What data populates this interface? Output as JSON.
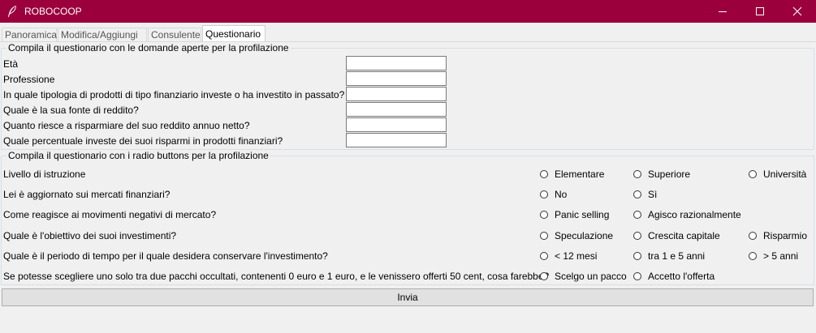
{
  "window": {
    "title": "ROBOCOOP"
  },
  "tabs": [
    {
      "label": "Panoramica"
    },
    {
      "label": "Modifica/Aggiungi"
    },
    {
      "label": "Consulente"
    },
    {
      "label": "Questionario"
    }
  ],
  "open_questions": {
    "title": "Compila il questionario con le domande aperte per la profilazione",
    "fields": [
      {
        "label": "Età",
        "value": ""
      },
      {
        "label": "Professione",
        "value": ""
      },
      {
        "label": "In quale tipologia di prodotti di tipo finanziario investe o ha investito in passato?",
        "value": ""
      },
      {
        "label": "Quale è la sua fonte di reddito?",
        "value": ""
      },
      {
        "label": "Quanto riesce a risparmiare del suo reddito annuo netto?",
        "value": ""
      },
      {
        "label": "Quale percentuale investe dei suoi risparmi in prodotti finanziari?",
        "value": ""
      }
    ]
  },
  "radio_questions": {
    "title": "Compila il questionario con i radio buttons per la profilazione",
    "items": [
      {
        "label": "Livello di istruzione",
        "options": [
          "Elementare",
          "Superiore",
          "Università"
        ]
      },
      {
        "label": "Lei è aggiornato sui mercati finanziari?",
        "options": [
          "No",
          "Sì"
        ]
      },
      {
        "label": "Come reagisce ai movimenti negativi di mercato?",
        "options": [
          "Panic selling",
          "Agisco razionalmente"
        ]
      },
      {
        "label": "Quale è l'obiettivo dei suoi investimenti?",
        "options": [
          "Speculazione",
          "Crescita capitale",
          "Risparmio"
        ]
      },
      {
        "label": "Quale è il periodo di tempo per il quale desidera conservare l'investimento?",
        "options": [
          "< 12 mesi",
          "tra 1 e 5 anni",
          "> 5 anni"
        ]
      },
      {
        "label": "Se potesse scegliere uno solo tra due pacchi occultati, contenenti 0 euro e 1 euro, e le venissero offerti 50 cent, cosa farebbe?",
        "options": [
          "Scelgo un pacco",
          "Accetto l'offerta"
        ]
      }
    ]
  },
  "submit": {
    "label": "Invia"
  }
}
